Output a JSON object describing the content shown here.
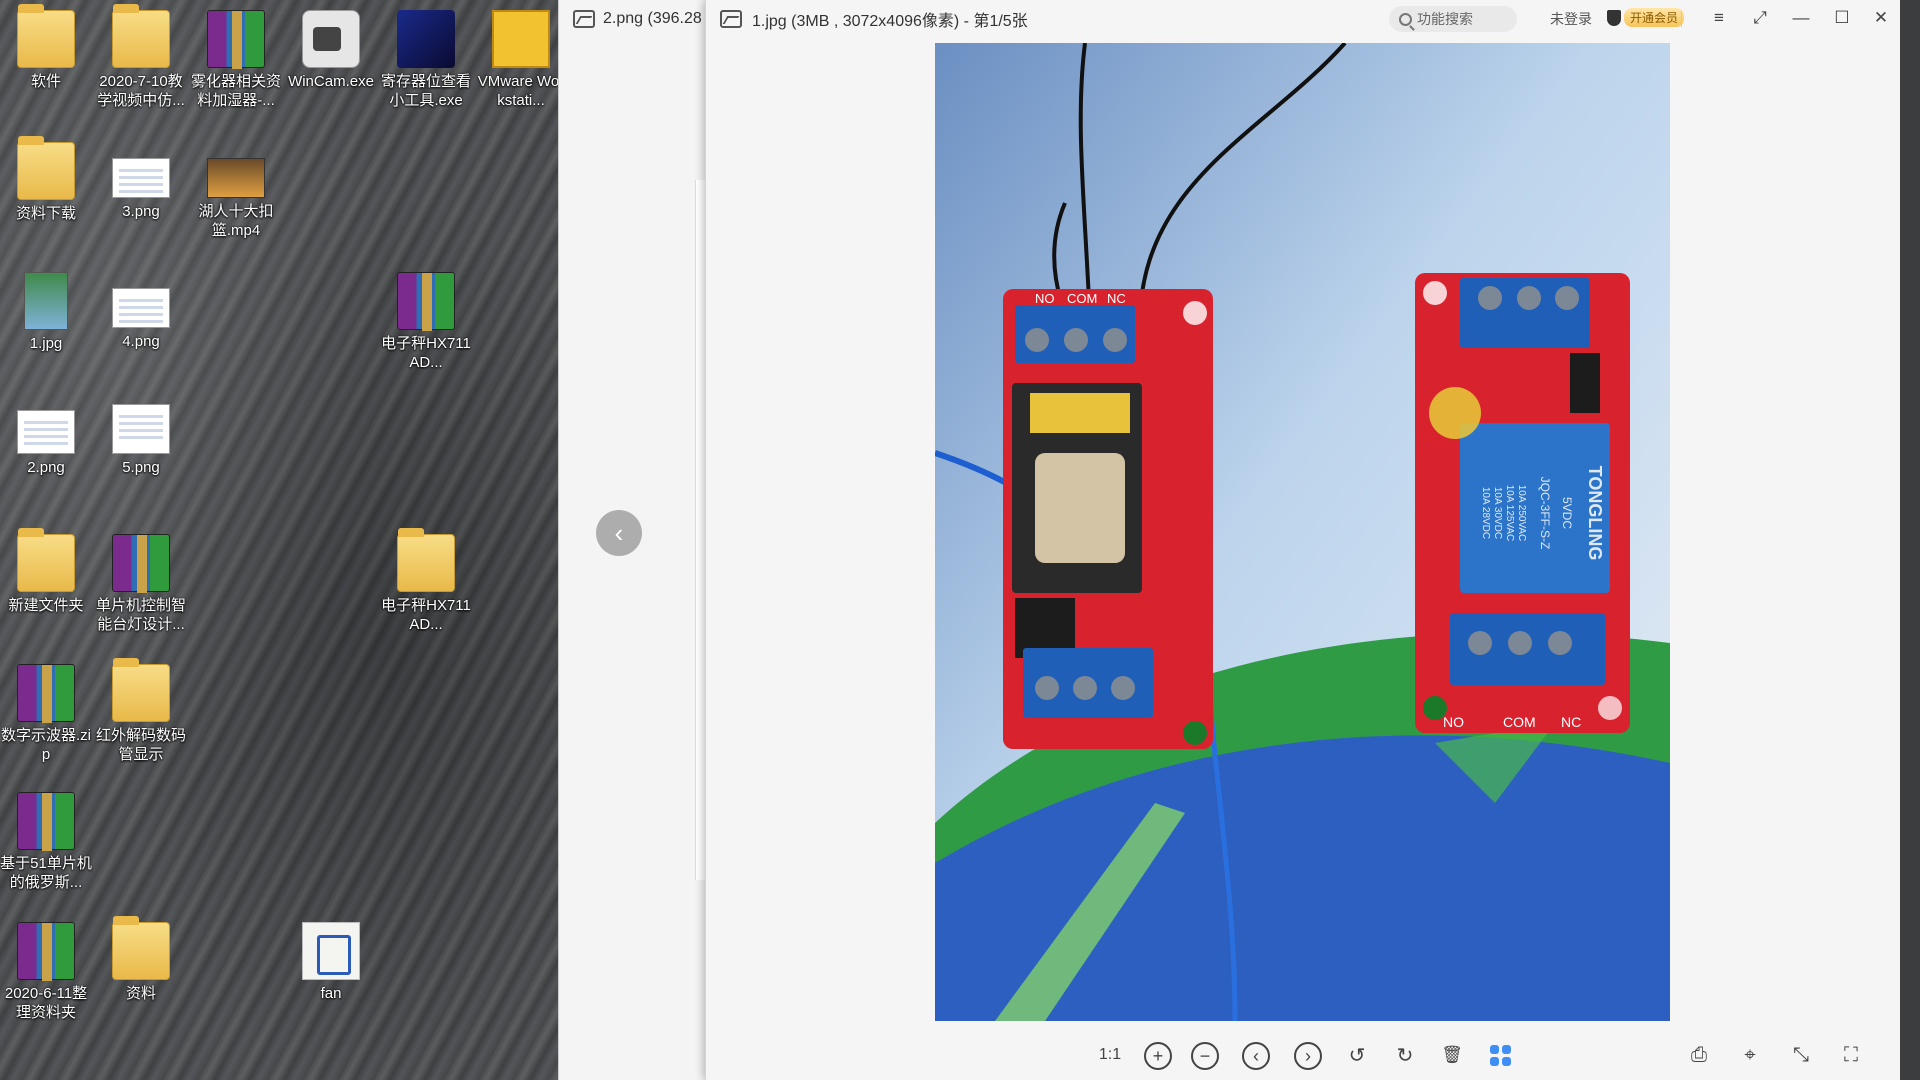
{
  "desktop": {
    "icons": [
      {
        "label": "软件",
        "type": "folder"
      },
      {
        "label": "2020-7-10教学视频中仿...",
        "type": "folder"
      },
      {
        "label": "雾化器相关资料加湿器-...",
        "type": "rar"
      },
      {
        "label": "WinCam.exe",
        "type": "app-cam"
      },
      {
        "label": "寄存器位查看小工具.exe",
        "type": "app-reg"
      },
      {
        "label": "VMware Workstati...",
        "type": "app-vmware"
      },
      {
        "label": "资料下载",
        "type": "folder"
      },
      {
        "label": "3.png",
        "type": "png"
      },
      {
        "label": "湖人十大扣篮.mp4",
        "type": "video"
      },
      {
        "label": "1.jpg",
        "type": "jpg"
      },
      {
        "label": "4.png",
        "type": "png"
      },
      {
        "label": "电子秤HX711AD...",
        "type": "rar"
      },
      {
        "label": "2.png",
        "type": "png"
      },
      {
        "label": "5.png",
        "type": "png"
      },
      {
        "label": "新建文件夹",
        "type": "folder"
      },
      {
        "label": "单片机控制智能台灯设计...",
        "type": "rar"
      },
      {
        "label": "电子秤HX711AD...",
        "type": "folder"
      },
      {
        "label": "数字示波器.zip",
        "type": "rar"
      },
      {
        "label": "红外解码数码管显示",
        "type": "folder"
      },
      {
        "label": "基于51单片机的俄罗斯...",
        "type": "rar"
      },
      {
        "label": "2020-6-11整理资料夹",
        "type": "rar"
      },
      {
        "label": "资料",
        "type": "folder"
      },
      {
        "label": "fan",
        "type": "doc"
      }
    ]
  },
  "back_window": {
    "title": "2.png (396.28"
  },
  "viewer": {
    "title": "1.jpg (3MB , 3072x4096像素) - 第1/5张",
    "search_placeholder": "功能搜索",
    "login_label": "未登录",
    "vip_label": "开通会员",
    "window_buttons": {
      "menu": "≡",
      "fullscreen": "⤢",
      "minimize": "—",
      "maximize": "☐",
      "close": "✕"
    },
    "toolbar": {
      "actual_size": "1:1",
      "zoom_in": "+",
      "zoom_out": "−",
      "prev": "‹",
      "next": "›",
      "rotate_left": "↺",
      "rotate_right": "↻",
      "delete": "🗑",
      "print": "⎙",
      "ocr": "⌖",
      "fit": "⤡",
      "fullscreen": "⛶"
    },
    "photo": {
      "left_board_labels": [
        "NO",
        "COM",
        "NC"
      ],
      "right_board_labels": [
        "NO",
        "COM",
        "NC"
      ],
      "relay_text": [
        "TONGLING",
        "5VDC",
        "JQC-3FF-S-Z",
        "10A 250VAC",
        "10A 125VAC",
        "10A 30VDC",
        "10A 28VDC"
      ]
    }
  },
  "colors": {
    "viewer_bg": "#f5f5f5",
    "accent_blue": "#3f8ef5",
    "pcb_red": "#d8232f",
    "terminal_blue": "#1f5fb8"
  }
}
